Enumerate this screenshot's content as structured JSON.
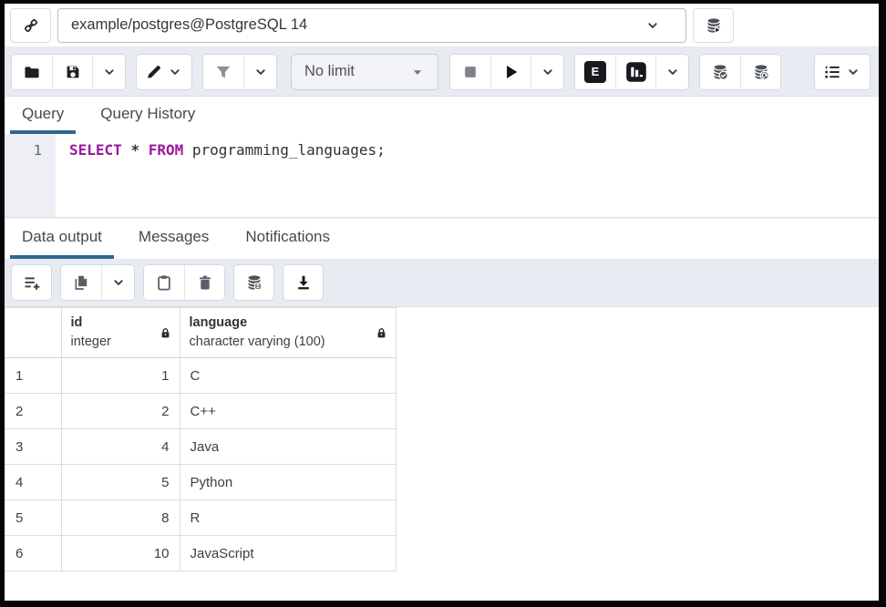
{
  "titlebar": {
    "connection": "example/postgres@PostgreSQL 14"
  },
  "main_toolbar": {
    "limit_value": "No limit",
    "explain_label": "E"
  },
  "editor_tabs": {
    "query": "Query",
    "query_history": "Query History"
  },
  "editor": {
    "line_number": "1",
    "sql": {
      "kw_select": "SELECT",
      "star": "*",
      "kw_from": "FROM",
      "identifier": " programming_languages;"
    }
  },
  "output_tabs": {
    "data_output": "Data output",
    "messages": "Messages",
    "notifications": "Notifications"
  },
  "results": {
    "columns": [
      {
        "name": "id",
        "type": "integer"
      },
      {
        "name": "language",
        "type": "character varying (100)"
      }
    ],
    "rows": [
      {
        "n": "1",
        "id": "1",
        "language": "C"
      },
      {
        "n": "2",
        "id": "2",
        "language": "C++"
      },
      {
        "n": "3",
        "id": "4",
        "language": "Java"
      },
      {
        "n": "4",
        "id": "5",
        "language": "Python"
      },
      {
        "n": "5",
        "id": "8",
        "language": "R"
      },
      {
        "n": "6",
        "id": "10",
        "language": "JavaScript"
      }
    ]
  },
  "icons": {
    "topbar": [
      "connection-plug-icon",
      "chevron-down-icon",
      "new-connection-database-icon"
    ],
    "main_toolbar": [
      "open-file-folder-icon",
      "save-icon",
      "edit-pencil-icon",
      "filter-icon",
      "stop-icon",
      "execute-play-icon",
      "explain-icon",
      "explain-analyze-chart-icon",
      "commit-database-check-icon",
      "rollback-database-undo-icon",
      "macros-list-icon"
    ],
    "results_toolbar": [
      "add-row-icon",
      "copy-icon",
      "paste-clipboard-icon",
      "delete-trash-icon",
      "save-data-database-icon",
      "download-icon"
    ],
    "grid": [
      "lock-icon"
    ]
  },
  "colors": {
    "accent_tab_underline": "#2f6690",
    "toolbar_background": "#e9ebf2",
    "sql_keyword": "#9b189b",
    "frame_border": "#050505"
  }
}
